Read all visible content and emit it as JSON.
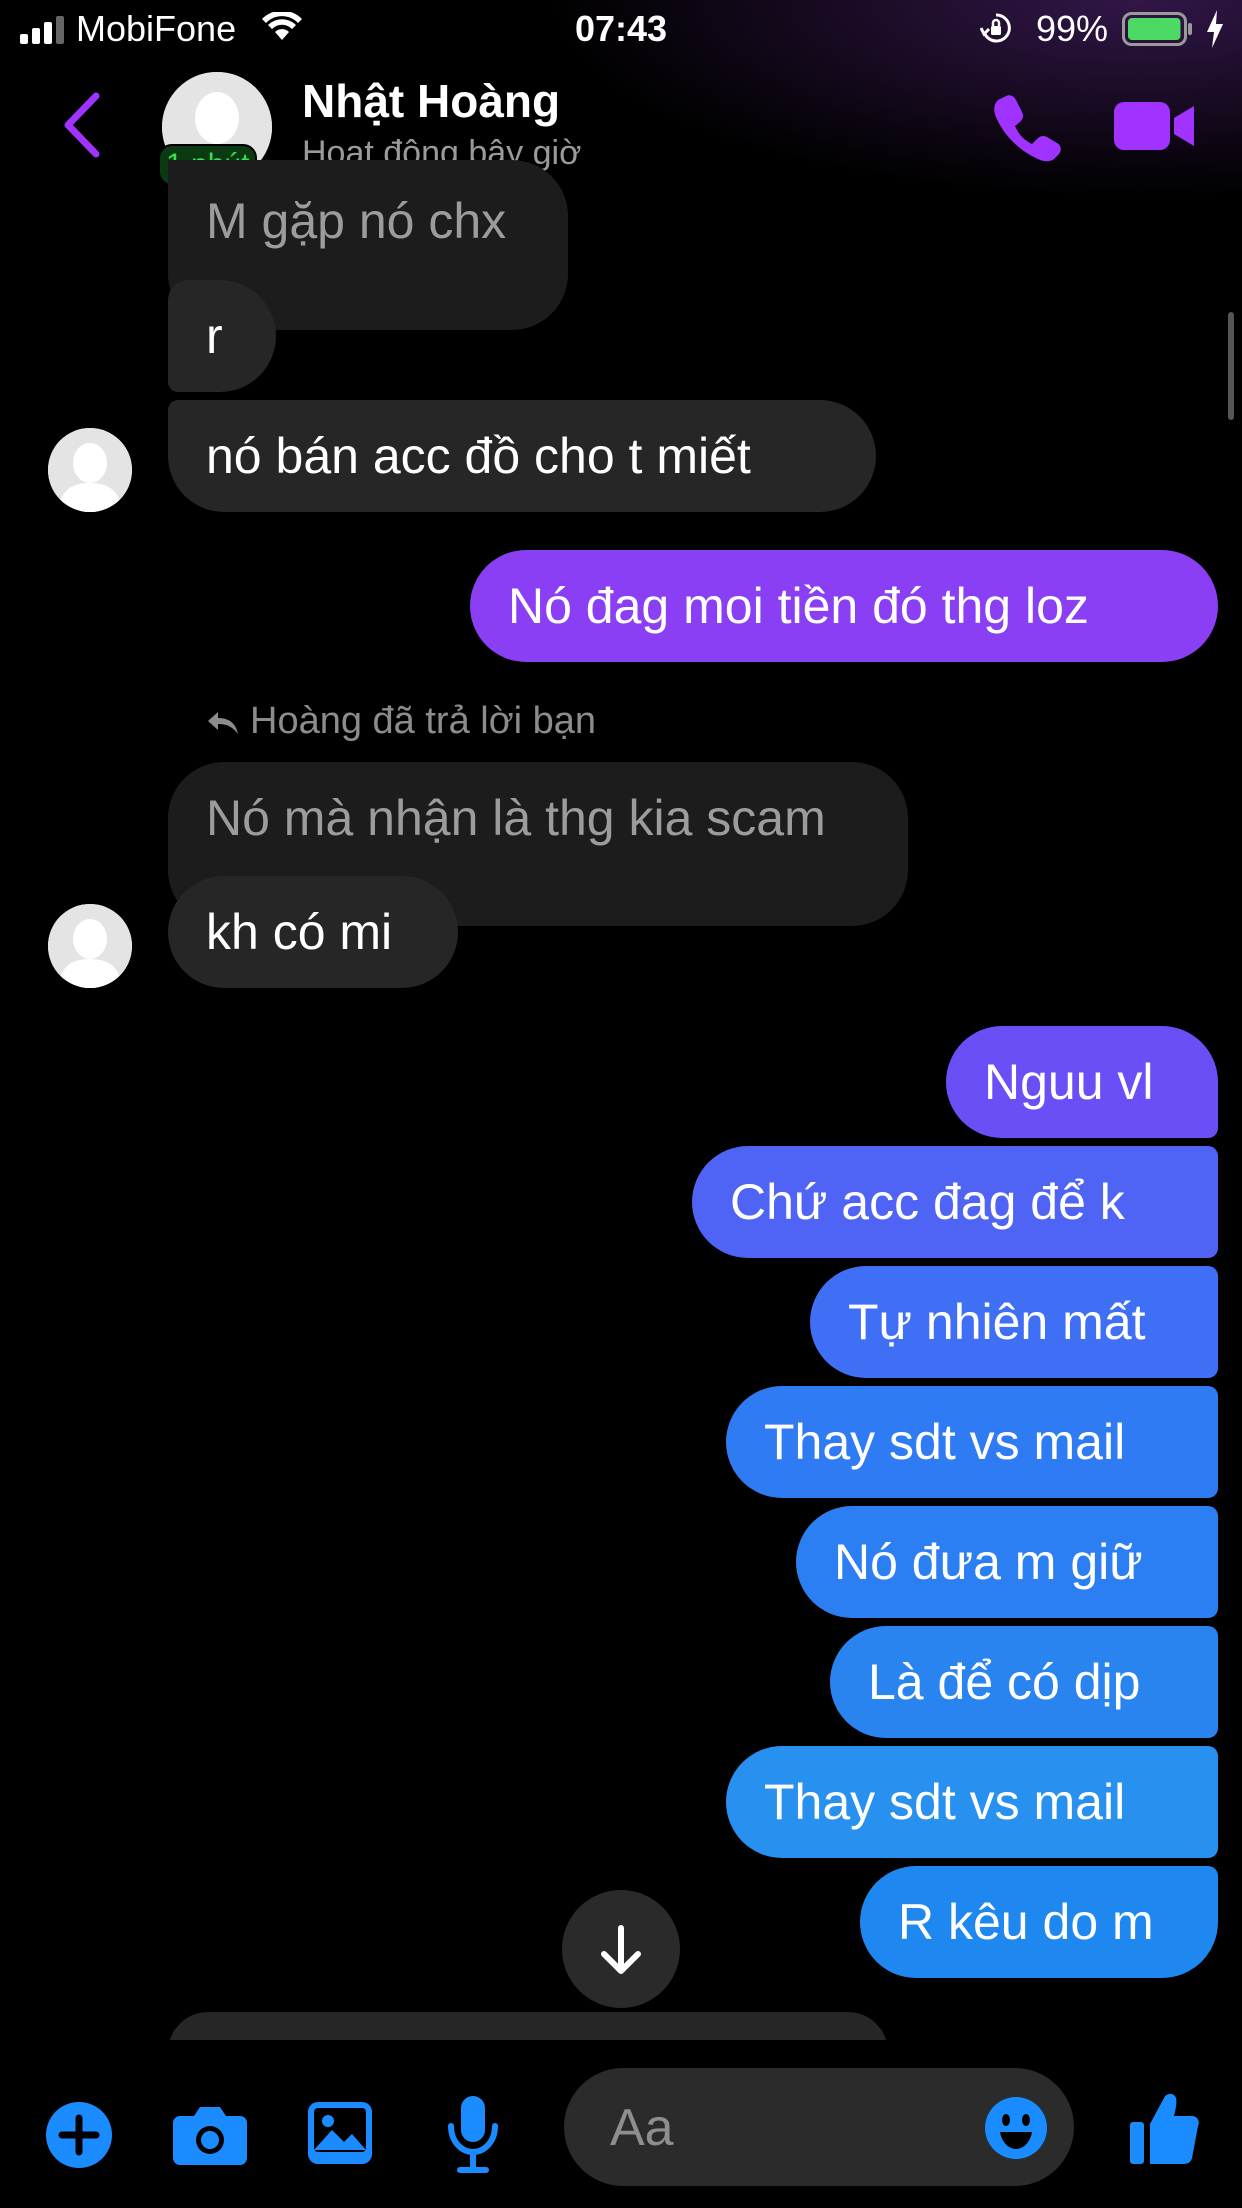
{
  "status_bar": {
    "carrier": "MobiFone",
    "time": "07:43",
    "battery_percent": "99%",
    "battery_level": 0.99,
    "icons": [
      "signal-icon",
      "wifi-icon",
      "orientation-lock-icon",
      "battery-icon",
      "charging-bolt-icon"
    ]
  },
  "header": {
    "contact_name": "Nhật Hoàng",
    "status": "Hoạt động bây giờ",
    "active_badge": "1 phút",
    "icons": [
      "back-chevron-icon",
      "phone-icon",
      "video-camera-icon"
    ]
  },
  "messages": [
    {
      "id": "m1",
      "from": "them",
      "text": "M gặp nó chx",
      "partially_visible": true
    },
    {
      "id": "m2",
      "from": "them",
      "text": "r"
    },
    {
      "id": "m3",
      "from": "them",
      "text": "nó bán acc đồ cho t miết"
    },
    {
      "id": "m4",
      "from": "me",
      "text": "Nó đag moi tiền đó thg loz"
    },
    {
      "id": "m5",
      "from": "them",
      "reply_note": "Hoàng đã trả lời bạn",
      "text": "Nó mà nhận là thg kia scam",
      "quoted": true
    },
    {
      "id": "m6",
      "from": "them",
      "text": "kh có mi"
    },
    {
      "id": "m7",
      "from": "me",
      "text": "Nguu vl"
    },
    {
      "id": "m8",
      "from": "me",
      "text": "Chứ acc đag để k"
    },
    {
      "id": "m9",
      "from": "me",
      "text": "Tự nhiên mất"
    },
    {
      "id": "m10",
      "from": "me",
      "text": "Thay sdt vs mail"
    },
    {
      "id": "m11",
      "from": "me",
      "text": "Nó đưa m giữ"
    },
    {
      "id": "m12",
      "from": "me",
      "text": "Là để có dịp"
    },
    {
      "id": "m13",
      "from": "me",
      "text": "Thay sdt vs mail"
    },
    {
      "id": "m14",
      "from": "me",
      "text": "R kêu do m"
    }
  ],
  "composer": {
    "placeholder": "Aa",
    "icons": [
      "plus-icon",
      "camera-icon",
      "gallery-icon",
      "microphone-icon",
      "emoji-icon",
      "thumbs-up-icon"
    ]
  },
  "colors": {
    "background": "#000000",
    "accent_purple": "#a033ff",
    "incoming_bubble": "#262626",
    "outgoing_gradient": [
      "#8a3ff5",
      "#6a4ff6",
      "#4f63f5",
      "#3f6ff4",
      "#2f7bf3",
      "#2b7ff2",
      "#2a84f0",
      "#2890ef",
      "#1f88f0"
    ],
    "composer_blue": "#1a8cff",
    "active_green": "#36e04f"
  }
}
